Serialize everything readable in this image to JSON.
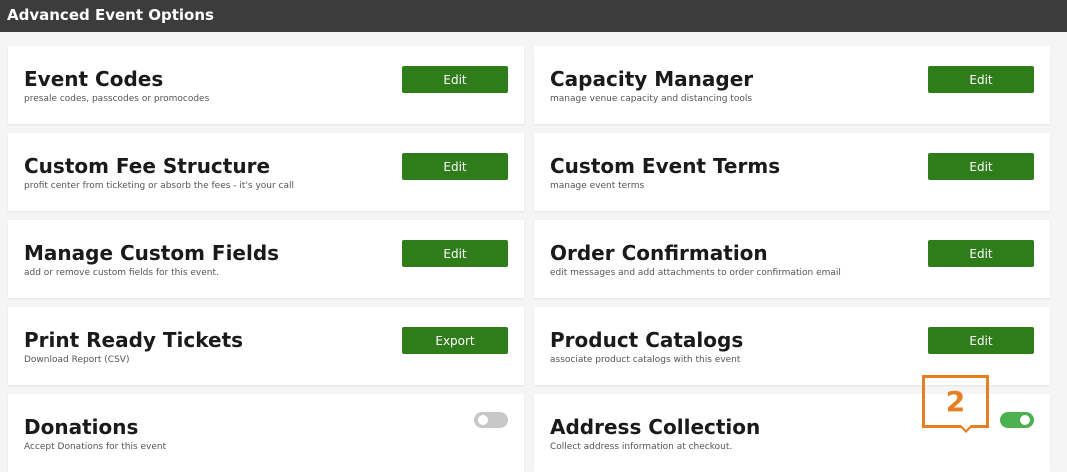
{
  "header": {
    "title": "Advanced Event Options"
  },
  "options": [
    {
      "title": "Event Codes",
      "subtitle": "presale codes, passcodes or promocodes",
      "action": "Edit"
    },
    {
      "title": "Capacity Manager",
      "subtitle": "manage venue capacity and distancing tools",
      "action": "Edit"
    },
    {
      "title": "Custom Fee Structure",
      "subtitle": "profit center from ticketing or absorb the fees - it's your call",
      "action": "Edit"
    },
    {
      "title": "Custom Event Terms",
      "subtitle": "manage event terms",
      "action": "Edit"
    },
    {
      "title": "Manage Custom Fields",
      "subtitle": "add or remove custom fields for this event.",
      "action": "Edit"
    },
    {
      "title": "Order Confirmation",
      "subtitle": "edit messages and add attachments to order confirmation email",
      "action": "Edit"
    },
    {
      "title": "Print Ready Tickets",
      "subtitle": "Download Report (CSV)",
      "action": "Export"
    },
    {
      "title": "Product Catalogs",
      "subtitle": "associate product catalogs with this event",
      "action": "Edit"
    },
    {
      "title": "Donations",
      "subtitle": "Accept Donations for this event",
      "toggle": "off"
    },
    {
      "title": "Address Collection",
      "subtitle": "Collect address information at checkout.",
      "toggle": "on"
    }
  ],
  "callout": {
    "label": "2",
    "color": "#e67e22"
  },
  "colors": {
    "header_bg": "#3c3c3c",
    "button_bg": "#2e7d1a",
    "toggle_on": "#4caf50",
    "toggle_off": "#c8c8c8"
  }
}
